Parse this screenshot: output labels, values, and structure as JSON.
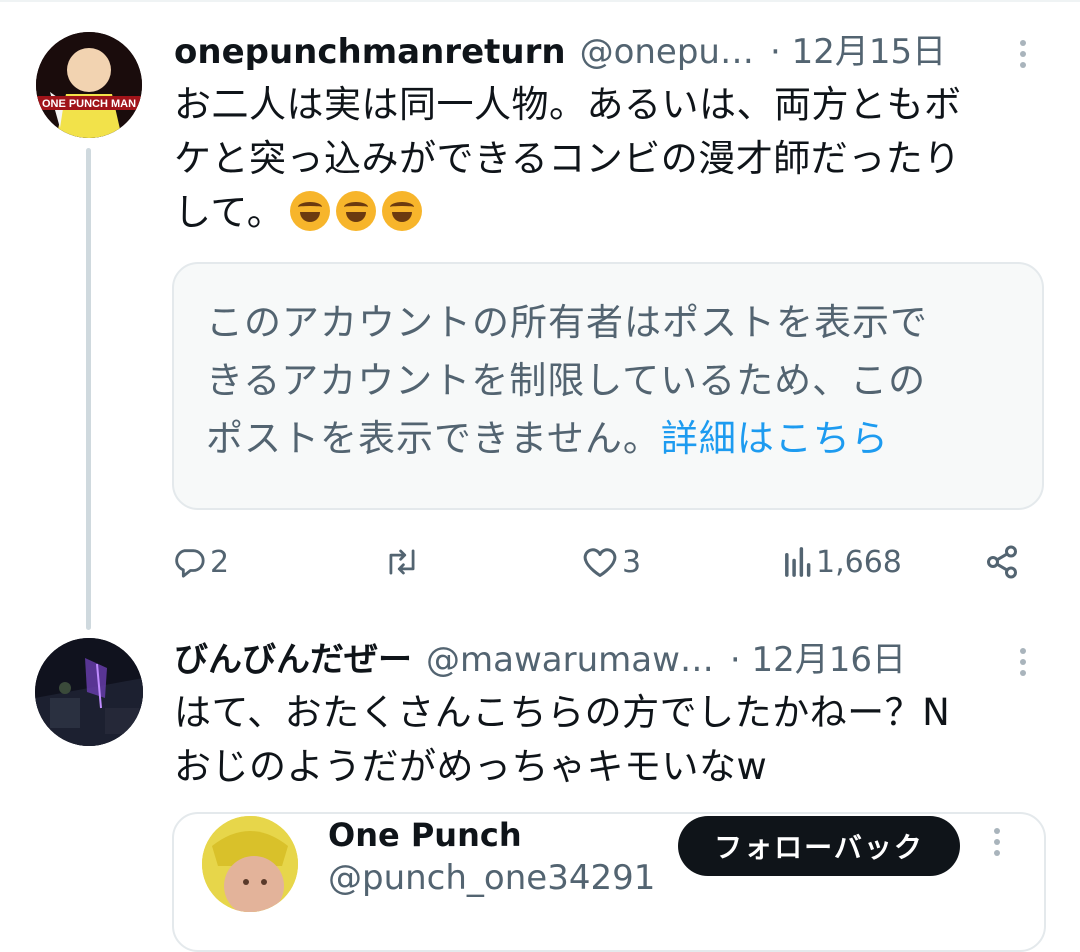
{
  "posts": [
    {
      "display_name": "onepunchmanreturn",
      "handle": "@onepu…",
      "date": "· 12月15日",
      "avatar_text": "ONE PUNCH MAN",
      "text_lines": [
        "お二人は実は同一人物。あるいは、両方ともボ",
        "ケと突っ込みができるコンビの漫才師だったり",
        "して。"
      ],
      "emoji": [
        "rolling-on-floor-laughing",
        "rolling-on-floor-laughing",
        "rolling-on-floor-laughing"
      ],
      "notice": {
        "lines": [
          "このアカウントの所有者はポストを表示で",
          "きるアカウントを制限しているため、この",
          "ポストを表示できません。"
        ],
        "link_text": "詳細はこちら"
      },
      "actions": {
        "replies": "2",
        "reposts": "",
        "likes": "3",
        "views": "1,668"
      }
    },
    {
      "display_name": "びんびんだぜー",
      "handle": "@mawarumaw…",
      "date": "· 12月16日",
      "text_lines": [
        "はて、おたくさんこちらの方でしたかねー？N",
        "おじのようだがめっちゃキモいなw"
      ],
      "quoted_user": {
        "name": "One Punch",
        "handle": "@punch_one34291",
        "follow_label": "フォローバック"
      }
    }
  ],
  "colors": {
    "text_primary": "#0f1419",
    "text_secondary": "#536471",
    "link": "#1d9bf0",
    "border": "#e4e9ec",
    "thread_line": "#cfd9de"
  }
}
